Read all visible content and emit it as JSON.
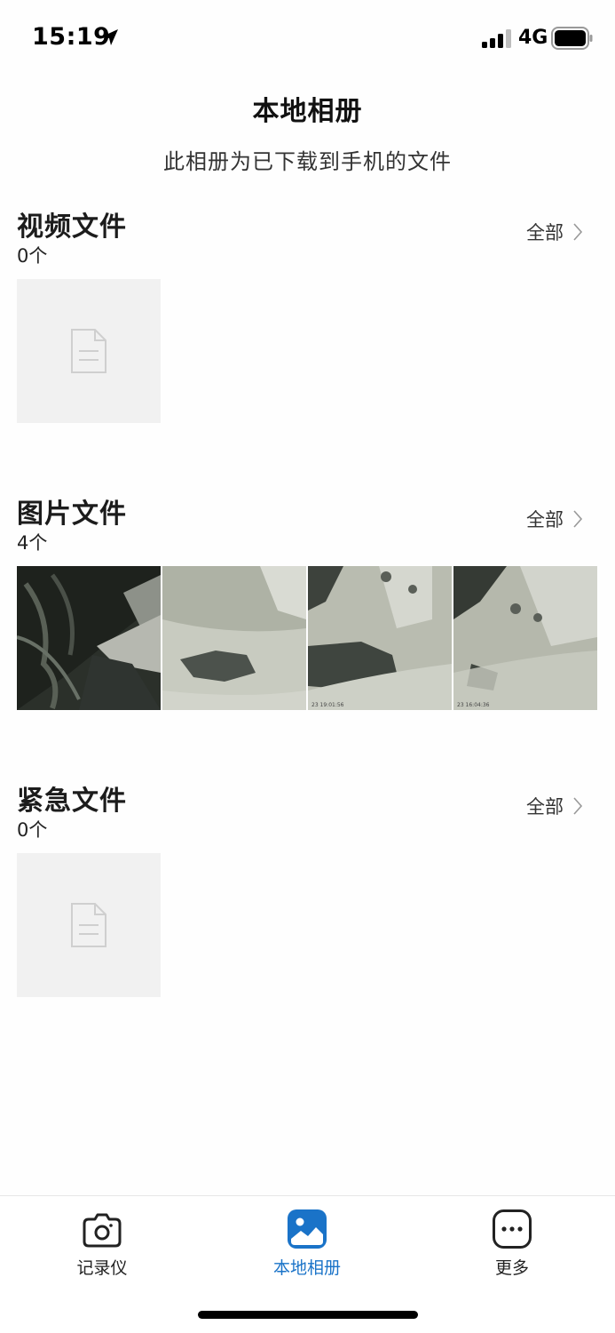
{
  "status_bar": {
    "time": "15:19",
    "network": "4G",
    "icons": [
      "location-arrow-icon",
      "signal-icon",
      "battery-icon"
    ]
  },
  "header": {
    "title": "本地相册",
    "subtitle": "此相册为已下载到手机的文件"
  },
  "sections": [
    {
      "title": "视频文件",
      "count": "0个",
      "all_label": "全部",
      "has_items": false
    },
    {
      "title": "图片文件",
      "count": "4个",
      "all_label": "全部",
      "has_items": true
    },
    {
      "title": "紧急文件",
      "count": "0个",
      "all_label": "全部",
      "has_items": false
    }
  ],
  "tabs": [
    {
      "label": "记录仪",
      "icon": "camera-icon",
      "active": false
    },
    {
      "label": "本地相册",
      "icon": "album-icon",
      "active": true
    },
    {
      "label": "更多",
      "icon": "more-icon",
      "active": false
    }
  ],
  "colors": {
    "accent": "#1a73c8",
    "placeholder_bg": "#f1f1f1",
    "text_primary": "#1c1c1c"
  }
}
